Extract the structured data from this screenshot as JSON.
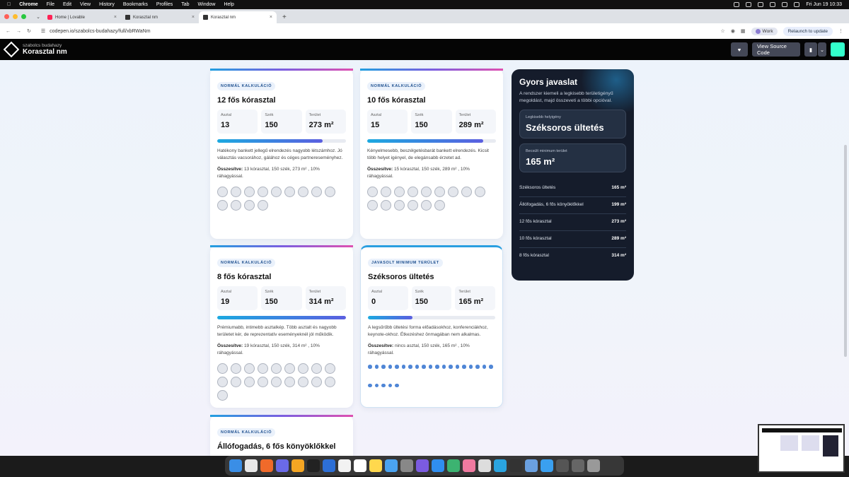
{
  "menubar": {
    "app": "Chrome",
    "items": [
      "File",
      "Edit",
      "View",
      "History",
      "Bookmarks",
      "Profiles",
      "Tab",
      "Window",
      "Help"
    ],
    "clock": "Fri Jun 19  10:33"
  },
  "browser": {
    "tabs": [
      {
        "title": "Home | Lovable"
      },
      {
        "title": "Korasztal nm"
      },
      {
        "title": "Korasztal nm"
      }
    ],
    "new_tab": "+",
    "url": "codepen.io/szabolcs-budahazy/full/xbRWaNm",
    "profile": "Work",
    "relaunch": "Relaunch to update"
  },
  "codepen": {
    "author": "szabolcs budahazy",
    "title": "Korasztal nm",
    "view_source": "View Source Code"
  },
  "cards": [
    {
      "badge": "NORMÁL KALKULÁCIÓ",
      "title": "12 fős kórasztal",
      "stats": [
        {
          "label": "Asztal",
          "value": "13"
        },
        {
          "label": "Szék",
          "value": "150"
        },
        {
          "label": "Terület",
          "value": "273 m²"
        }
      ],
      "bar_fill": 0.82,
      "desc": "Hatékony bankett jellegű elrendezés nagyobb létszámhoz. Jó választás vacsorához, gálához és céges partnereseményhez.",
      "summary_label": "Összesítve:",
      "summary_text": " 13 kórasztal, 150 szék, 273 m² , 10% ráhagyással.",
      "tables": 13
    },
    {
      "badge": "NORMÁL KALKULÁCIÓ",
      "title": "10 fős kórasztal",
      "stats": [
        {
          "label": "Asztal",
          "value": "15"
        },
        {
          "label": "Szék",
          "value": "150"
        },
        {
          "label": "Terület",
          "value": "289 m²"
        }
      ],
      "bar_fill": 0.9,
      "desc": "Kényelmesebb, beszélgetésbarát bankett elrendezés. Kicsit több helyet igényel, de elegánsabb érzetet ad.",
      "summary_label": "Összesítve:",
      "summary_text": " 15 kórasztal, 150 szék, 289 m² , 10% ráhagyással.",
      "tables": 15
    },
    {
      "badge": "NORMÁL KALKULÁCIÓ",
      "title": "8 fős kórasztal",
      "stats": [
        {
          "label": "Asztal",
          "value": "19"
        },
        {
          "label": "Szék",
          "value": "150"
        },
        {
          "label": "Terület",
          "value": "314 m²"
        }
      ],
      "bar_fill": 1.0,
      "desc": "Prémiumabb, intimebb asztalkép. Több asztalt és nagyobb területet kér, de reprezentatív eseményeknél jól működik.",
      "summary_label": "Összesítve:",
      "summary_text": " 19 kórasztal, 150 szék, 314 m² , 10% ráhagyással.",
      "tables": 19
    },
    {
      "badge": "JAVASOLT MINIMUM TERÜLET",
      "title": "Széksoros ültetés",
      "stats": [
        {
          "label": "Asztal",
          "value": "0"
        },
        {
          "label": "Szék",
          "value": "150"
        },
        {
          "label": "Terület",
          "value": "165 m²"
        }
      ],
      "bar_fill": 0.35,
      "desc": "A legsűrűbb ültetési forma előadásokhoz, konferenciákhoz, keynote-okhoz. Étkezéshez önmagában nem alkalmas.",
      "summary_label": "Összesítve:",
      "summary_text": " nincs asztal, 150 szék, 165 m² , 10% ráhagyással.",
      "chairs_row1": 19,
      "chairs_row2": 5
    },
    {
      "badge": "NORMÁL KALKULÁCIÓ",
      "title": "Állófogadás, 6 fős könyöklőkkel"
    }
  ],
  "side": {
    "title": "Gyors javaslat",
    "text": "A rendszer kiemeli a legkisebb területigényű megoldást, majd összeveti a többi opcióval.",
    "best_label": "Legkisebb helyigény",
    "best_value": "Széksoros ültetés",
    "min_label": "Becsült minimum terület",
    "min_value": "165 m²",
    "list": [
      {
        "name": "Széksoros ültetés",
        "value": "165 m²"
      },
      {
        "name": "Állófogadás, 6 fős könyöklőkkel",
        "value": "199 m²"
      },
      {
        "name": "12 fős kórasztal",
        "value": "273 m²"
      },
      {
        "name": "10 fős kórasztal",
        "value": "289 m²"
      },
      {
        "name": "8 fős kórasztal",
        "value": "314 m²"
      }
    ]
  },
  "colors": {
    "accent": "#4f86d6",
    "dark_panel": "#151c2b",
    "page_bg": "#edf3fb"
  }
}
